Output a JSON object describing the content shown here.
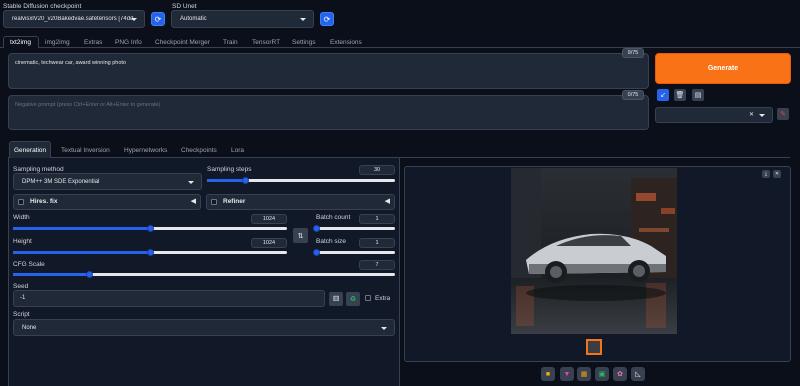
{
  "header": {
    "checkpoint_label": "Stable Diffusion checkpoint",
    "checkpoint_value": "realvisxlV20_v20Bakedvae.safetensors [74dda4",
    "unet_label": "SD Unet",
    "unet_value": "Automatic"
  },
  "main_tabs": [
    {
      "label": "txt2img"
    },
    {
      "label": "img2img"
    },
    {
      "label": "Extras"
    },
    {
      "label": "PNG Info"
    },
    {
      "label": "Checkpoint Merger"
    },
    {
      "label": "Train"
    },
    {
      "label": "TensorRT"
    },
    {
      "label": "Settings"
    },
    {
      "label": "Extensions"
    }
  ],
  "prompt": {
    "value": "cinematic, techwear car, award winning photo",
    "counter": "9/75"
  },
  "negative_prompt": {
    "placeholder": "Negative prompt (press Ctrl+Enter or Alt+Enter to generate)",
    "counter": "0/75"
  },
  "generate_label": "Generate",
  "accent_color": "#f97316",
  "sub_tabs": [
    {
      "label": "Generation"
    },
    {
      "label": "Textual Inversion"
    },
    {
      "label": "Hypernetworks"
    },
    {
      "label": "Checkpoints"
    },
    {
      "label": "Lora"
    }
  ],
  "sampling": {
    "method_label": "Sampling method",
    "method_value": "DPM++ 3M SDE Exponential",
    "steps_label": "Sampling steps",
    "steps_value": "30",
    "steps_fraction": 0.2
  },
  "hires_label": "Hires. fix",
  "refiner_label": "Refiner",
  "width": {
    "label": "Width",
    "value": "1024",
    "fraction": 0.5
  },
  "height": {
    "label": "Height",
    "value": "1024",
    "fraction": 0.5
  },
  "batch_count": {
    "label": "Batch count",
    "value": "1",
    "fraction": 0.0
  },
  "batch_size": {
    "label": "Batch size",
    "value": "1",
    "fraction": 0.0
  },
  "cfg": {
    "label": "CFG Scale",
    "value": "7",
    "fraction": 0.2
  },
  "seed": {
    "label": "Seed",
    "value": "-1",
    "extra_label": "Extra"
  },
  "script": {
    "label": "Script",
    "value": "None"
  },
  "icons": [
    "refresh-icon",
    "dice-icon",
    "recycle-icon",
    "folder-icon",
    "save-icon",
    "zip-icon",
    "image-icon",
    "palette-icon",
    "chart-icon",
    "trash-icon",
    "clipboard-icon",
    "brush-icon"
  ]
}
